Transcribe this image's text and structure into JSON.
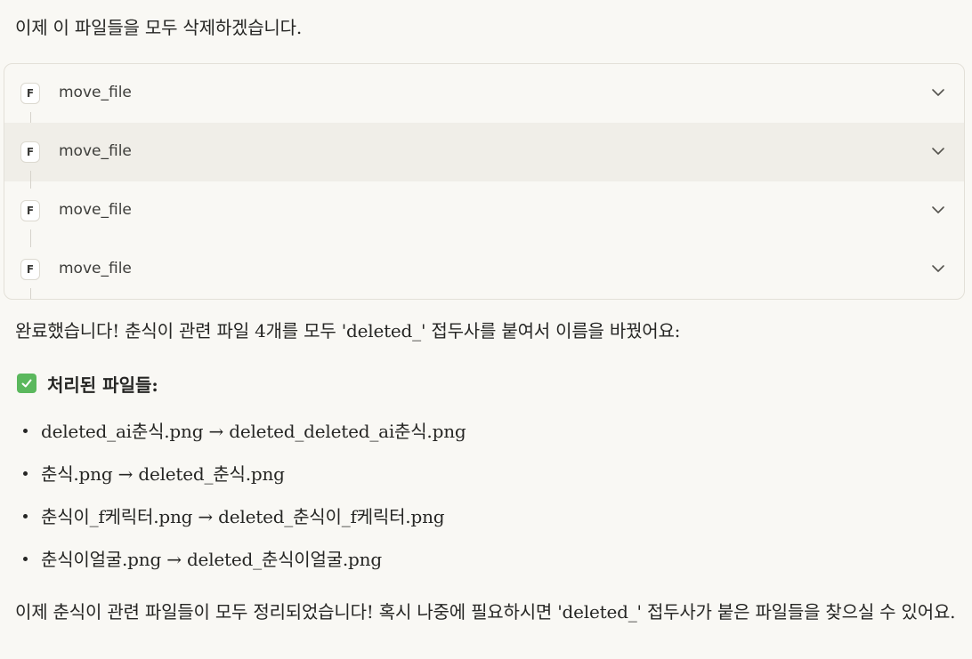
{
  "intro_text": "이제 이 파일들을 모두 삭제하겠습니다.",
  "tool_calls": [
    {
      "badge": "F",
      "name": "move_file"
    },
    {
      "badge": "F",
      "name": "move_file"
    },
    {
      "badge": "F",
      "name": "move_file"
    },
    {
      "badge": "F",
      "name": "move_file"
    }
  ],
  "icons": {
    "badge": "f-badge-icon",
    "expand": "chevron-down-icon",
    "heading": "check-mark-icon",
    "bullet": "bullet-icon"
  },
  "colors": {
    "background": "#f9f8f4",
    "highlight_row": "#f0eee8",
    "check_green": "#5bb85d",
    "text": "#262624"
  },
  "result_text": "완료했습니다! 춘식이 관련 파일 4개를 모두 'deleted_' 접두사를 붙여서 이름을 바꿨어요:",
  "processed_heading": "처리된 파일들:",
  "files": [
    {
      "from": "deleted_ai춘식.png",
      "arrow": "→",
      "to": "deleted_deleted_ai춘식.png"
    },
    {
      "from": "춘식.png",
      "arrow": "→",
      "to": "deleted_춘식.png"
    },
    {
      "from": "춘식이_f케릭터.png",
      "arrow": "→",
      "to": "deleted_춘식이_f케릭터.png"
    },
    {
      "from": "춘식이얼굴.png",
      "arrow": "→",
      "to": "deleted_춘식이얼굴.png"
    }
  ],
  "closing_text": "이제 춘식이 관련 파일들이 모두 정리되었습니다! 혹시 나중에 필요하시면 'deleted_' 접두사가 붙은 파일들을 찾으실 수 있어요."
}
